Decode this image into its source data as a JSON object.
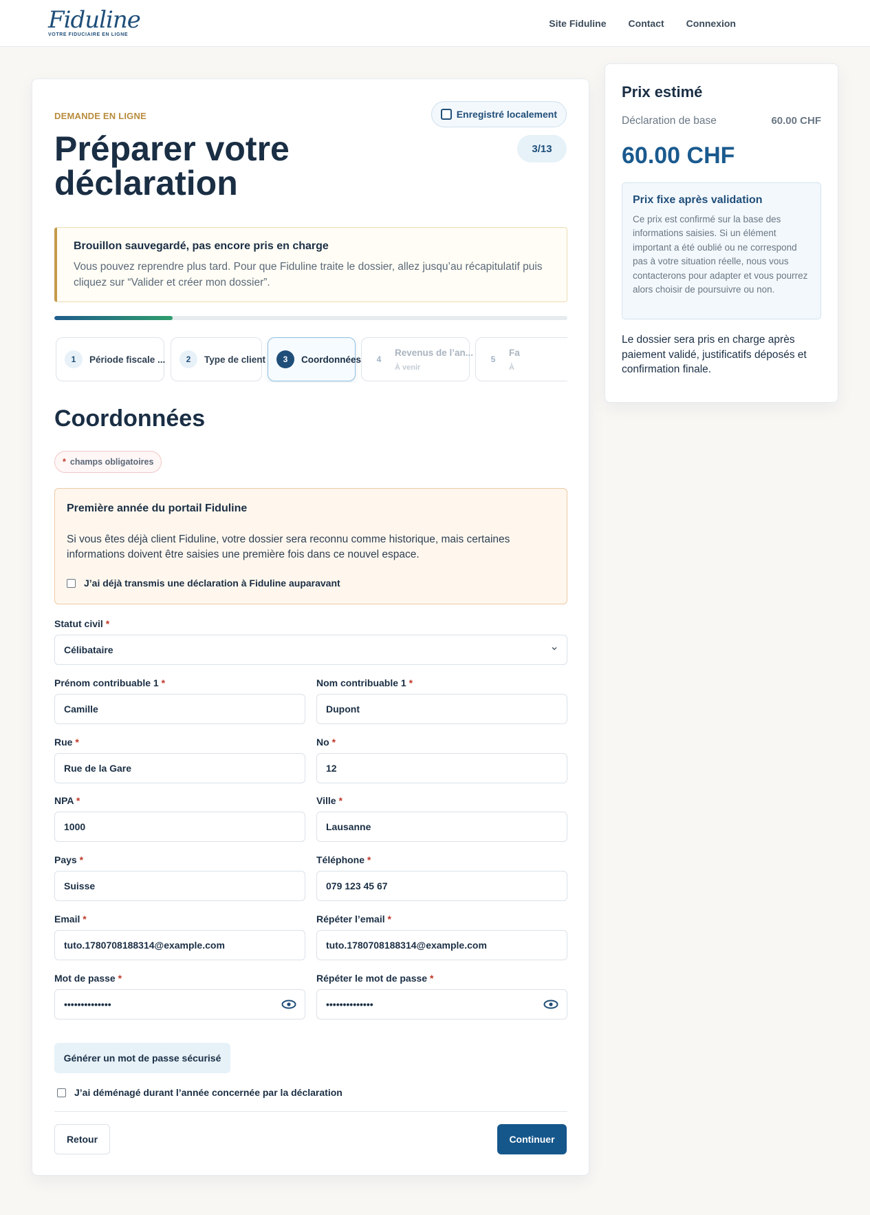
{
  "header": {
    "logo_main": "Fiduline",
    "logo_tagline": "VOTRE FIDUCIAIRE EN LIGNE",
    "nav": [
      {
        "label": "Site Fiduline"
      },
      {
        "label": "Contact"
      },
      {
        "label": "Connexion"
      }
    ]
  },
  "page": {
    "eyebrow": "DEMANDE EN LIGNE",
    "title": "Préparer votre déclaration",
    "local_save": "Enregistré localement",
    "step_count": "3/13"
  },
  "draft": {
    "title": "Brouillon sauvegardé, pas encore pris en charge",
    "text": "Vous pouvez reprendre plus tard. Pour que Fiduline traite le dossier, allez jusqu’au récapitulatif puis cliquez sur “Valider et créer mon dossier”."
  },
  "progress": {
    "value": 0.23
  },
  "steps": [
    {
      "num": "1",
      "label": "Période fiscale ...",
      "state": "done"
    },
    {
      "num": "2",
      "label": "Type de client",
      "state": "done"
    },
    {
      "num": "3",
      "label": "Coordonnées",
      "state": "active"
    },
    {
      "num": "4",
      "label": "Revenus de l’an...",
      "sub": "À venir",
      "state": "future"
    },
    {
      "num": "5",
      "label": "Fa",
      "sub": "À",
      "state": "future"
    }
  ],
  "section": {
    "title": "Coordonnées",
    "required_note_star": "*",
    "required_note": "champs obligatoires"
  },
  "first_year": {
    "title": "Première année du portail Fiduline",
    "text": "Si vous êtes déjà client Fiduline, votre dossier sera reconnu comme historique, mais certaines informations doivent être saisies une première fois dans ce nouvel espace.",
    "checkbox_label": "J’ai déjà transmis une déclaration à Fiduline auparavant",
    "checked": false
  },
  "form": {
    "required_star": "*",
    "statut_civil": {
      "label": "Statut civil",
      "value": "Célibataire"
    },
    "prenom": {
      "label": "Prénom contribuable 1",
      "value": "Camille"
    },
    "nom": {
      "label": "Nom contribuable 1",
      "value": "Dupont"
    },
    "rue": {
      "label": "Rue",
      "value": "Rue de la Gare"
    },
    "no": {
      "label": "No",
      "value": "12"
    },
    "npa": {
      "label": "NPA",
      "value": "1000"
    },
    "ville": {
      "label": "Ville",
      "value": "Lausanne"
    },
    "pays": {
      "label": "Pays",
      "value": "Suisse"
    },
    "telephone": {
      "label": "Téléphone",
      "value": "079 123 45 67"
    },
    "email": {
      "label": "Email",
      "value": "tuto.1780708188314@example.com"
    },
    "email_repeat": {
      "label": "Répéter l’email",
      "value": "tuto.1780708188314@example.com"
    },
    "password": {
      "label": "Mot de passe",
      "value": "••••••••••••••"
    },
    "password_repeat": {
      "label": "Répéter le mot de passe",
      "value": "••••••••••••••"
    },
    "generate_password": "Générer un mot de passe sécurisé",
    "moved_label": "J’ai déménagé durant l’année concernée par la déclaration",
    "moved_checked": false
  },
  "actions": {
    "back": "Retour",
    "next": "Continuer"
  },
  "price": {
    "title": "Prix estimé",
    "base_label": "Déclaration de base",
    "base_value": "60.00 CHF",
    "total": "60.00 CHF",
    "fixed_title": "Prix fixe après validation",
    "fixed_text": "Ce prix est confirmé sur la base des informations saisies. Si un élément important a été oublié ou ne correspond pas à votre situation réelle, nous vous contacterons pour adapter et vous pourrez alors choisir de poursuivre ou non.",
    "footer": "Le dossier sera pris en charge après paiement validé, justificatifs déposés et confirmation finale."
  },
  "colors": {
    "brand": "#1f4e79",
    "accent_gold": "#b88b3c",
    "primary_button": "#15568b",
    "required_star": "#c0392b"
  }
}
